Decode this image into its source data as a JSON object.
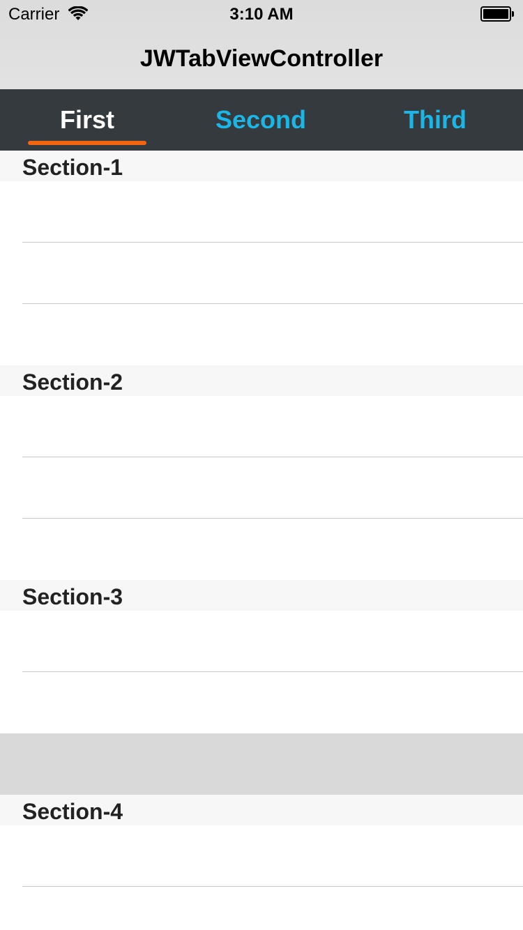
{
  "status_bar": {
    "carrier": "Carrier",
    "time": "3:10 AM",
    "wifi_icon": "wifi-icon",
    "battery_icon": "battery-full-icon"
  },
  "nav": {
    "title": "JWTabViewController"
  },
  "tabs": [
    {
      "label": "First",
      "active": true
    },
    {
      "label": "Second",
      "active": false
    },
    {
      "label": "Third",
      "active": false
    }
  ],
  "colors": {
    "tab_bar_bg": "#343a3d",
    "tab_active_text": "#ffffff",
    "tab_inactive_text": "#1bb5e6",
    "tab_indicator": "#f3650f",
    "section_header_bg": "#f7f7f7"
  },
  "sections": [
    {
      "title": "Section-1",
      "rows": 3
    },
    {
      "title": "Section-2",
      "rows": 3
    },
    {
      "title": "Section-3",
      "rows": 2
    },
    {
      "title": "Section-4",
      "rows": 2
    }
  ]
}
